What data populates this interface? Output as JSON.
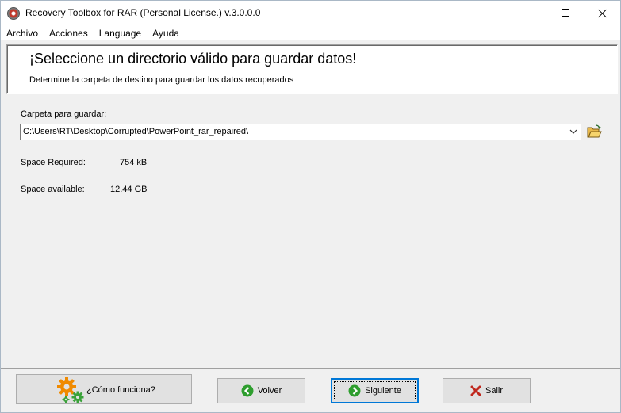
{
  "window": {
    "title": "Recovery Toolbox for RAR (Personal License.) v.3.0.0.0"
  },
  "menu": {
    "items": [
      "Archivo",
      "Acciones",
      "Language",
      "Ayuda"
    ]
  },
  "header": {
    "title": "¡Seleccione un directorio válido para guardar datos!",
    "subtitle": "Determine la carpeta de destino para guardar los datos recuperados"
  },
  "folder": {
    "label": "Carpeta para guardar:",
    "value": "C:\\Users\\RT\\Desktop\\Corrupted\\PowerPoint_rar_repaired\\"
  },
  "space": {
    "required_label": "Space Required:",
    "required_value": "754 kB",
    "available_label": "Space available:",
    "available_value": "12.44 GB"
  },
  "buttons": {
    "help": "¿Cómo funciona?",
    "back": "Volver",
    "next": "Siguiente",
    "exit": "Salir"
  },
  "colors": {
    "green_arrow": "#2e9e2e",
    "exit_x": "#c0281e",
    "gear_orange": "#f08a00",
    "gear_green": "#3aa23a",
    "focus_border": "#0078d7"
  },
  "icons": {
    "app": "rar-recovery-app-icon",
    "browse": "open-folder-icon",
    "help": "gears-icon",
    "back": "back-arrow-icon",
    "next": "next-arrow-icon",
    "exit": "red-x-icon"
  }
}
